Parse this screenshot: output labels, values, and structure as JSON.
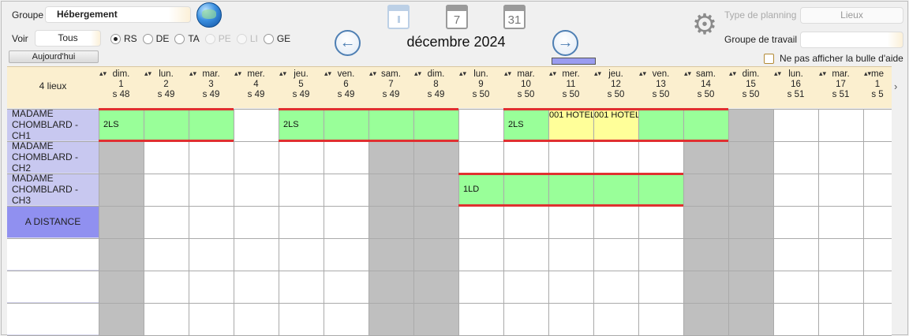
{
  "toolbar": {
    "groupe_label": "Groupe",
    "groupe_value": "Hébergement",
    "voir_label": "Voir",
    "voir_value": "Tous",
    "today_label": "Aujourd'hui",
    "radios": [
      {
        "label": "RS",
        "selected": true,
        "enabled": true
      },
      {
        "label": "DE",
        "selected": false,
        "enabled": true
      },
      {
        "label": "TA",
        "selected": false,
        "enabled": true
      },
      {
        "label": "PE",
        "selected": false,
        "enabled": false
      },
      {
        "label": "LI",
        "selected": false,
        "enabled": false
      },
      {
        "label": "GE",
        "selected": false,
        "enabled": true
      }
    ],
    "cal_icons": [
      "",
      "7",
      "31"
    ],
    "month": "décembre 2024",
    "type_planning_label": "Type de planning",
    "type_planning_value": "Lieux",
    "groupe_travail_label": "Groupe de travail",
    "groupe_travail_value": "",
    "help_bubble_label": "Ne pas afficher la bulle d'aide"
  },
  "grid": {
    "corner_label": "4 lieux",
    "days": [
      {
        "dow": "dim.",
        "num": "1",
        "week": "s 48"
      },
      {
        "dow": "lun.",
        "num": "2",
        "week": "s 49"
      },
      {
        "dow": "mar.",
        "num": "3",
        "week": "s 49"
      },
      {
        "dow": "mer.",
        "num": "4",
        "week": "s 49"
      },
      {
        "dow": "jeu.",
        "num": "5",
        "week": "s 49"
      },
      {
        "dow": "ven.",
        "num": "6",
        "week": "s 49"
      },
      {
        "dow": "sam.",
        "num": "7",
        "week": "s 49"
      },
      {
        "dow": "dim.",
        "num": "8",
        "week": "s 49"
      },
      {
        "dow": "lun.",
        "num": "9",
        "week": "s 50"
      },
      {
        "dow": "mar.",
        "num": "10",
        "week": "s 50"
      },
      {
        "dow": "mer.",
        "num": "11",
        "week": "s 50"
      },
      {
        "dow": "jeu.",
        "num": "12",
        "week": "s 50"
      },
      {
        "dow": "ven.",
        "num": "13",
        "week": "s 50"
      },
      {
        "dow": "sam.",
        "num": "14",
        "week": "s 50"
      },
      {
        "dow": "dim.",
        "num": "15",
        "week": "s 50"
      },
      {
        "dow": "lun.",
        "num": "16",
        "week": "s 51"
      },
      {
        "dow": "mar.",
        "num": "17",
        "week": "s 51"
      },
      {
        "dow": "me",
        "num": "1",
        "week": "s 5"
      }
    ],
    "rows": [
      {
        "label": "MADAME CHOMBLARD - CH1",
        "bg": "#c8c8f0"
      },
      {
        "label": "MADAME CHOMBLARD - CH2",
        "bg": "#c8c8f0"
      },
      {
        "label": "MADAME CHOMBLARD - CH3",
        "bg": "#c8c8f0"
      },
      {
        "label": "A DISTANCE",
        "bg": "#9090f0",
        "center": true
      },
      {
        "label": "",
        "bg": "#ffffff"
      },
      {
        "label": "",
        "bg": "#ffffff"
      },
      {
        "label": "",
        "bg": "#ffffff"
      }
    ],
    "bookings": [
      {
        "row": 0,
        "start": 0,
        "end": 2,
        "label": "2LS",
        "color": "#99ff99"
      },
      {
        "row": 0,
        "start": 4,
        "end": 7,
        "label": "2LS",
        "color": "#99ff99"
      },
      {
        "row": 0,
        "start": 9,
        "end": 9,
        "label": "2LS",
        "color": "#99ff99"
      },
      {
        "row": 0,
        "start": 10,
        "end": 10,
        "label": "001 HOTEL",
        "color": "#ffff99",
        "top": true
      },
      {
        "row": 0,
        "start": 11,
        "end": 11,
        "label": "001 HOTEL",
        "color": "#ffff99",
        "top": true
      },
      {
        "row": 0,
        "start": 12,
        "end": 13,
        "label": "",
        "color": "#99ff99"
      },
      {
        "row": 2,
        "start": 8,
        "end": 12,
        "label": "1LD",
        "color": "#99ff99"
      }
    ],
    "redbars": [
      {
        "row": 0,
        "start": 0,
        "end": 2
      },
      {
        "row": 0,
        "start": 4,
        "end": 7
      },
      {
        "row": 0,
        "start": 9,
        "end": 13
      },
      {
        "row": 2,
        "start": 8,
        "end": 12
      }
    ],
    "weekend_color": "#bfbfbf"
  }
}
